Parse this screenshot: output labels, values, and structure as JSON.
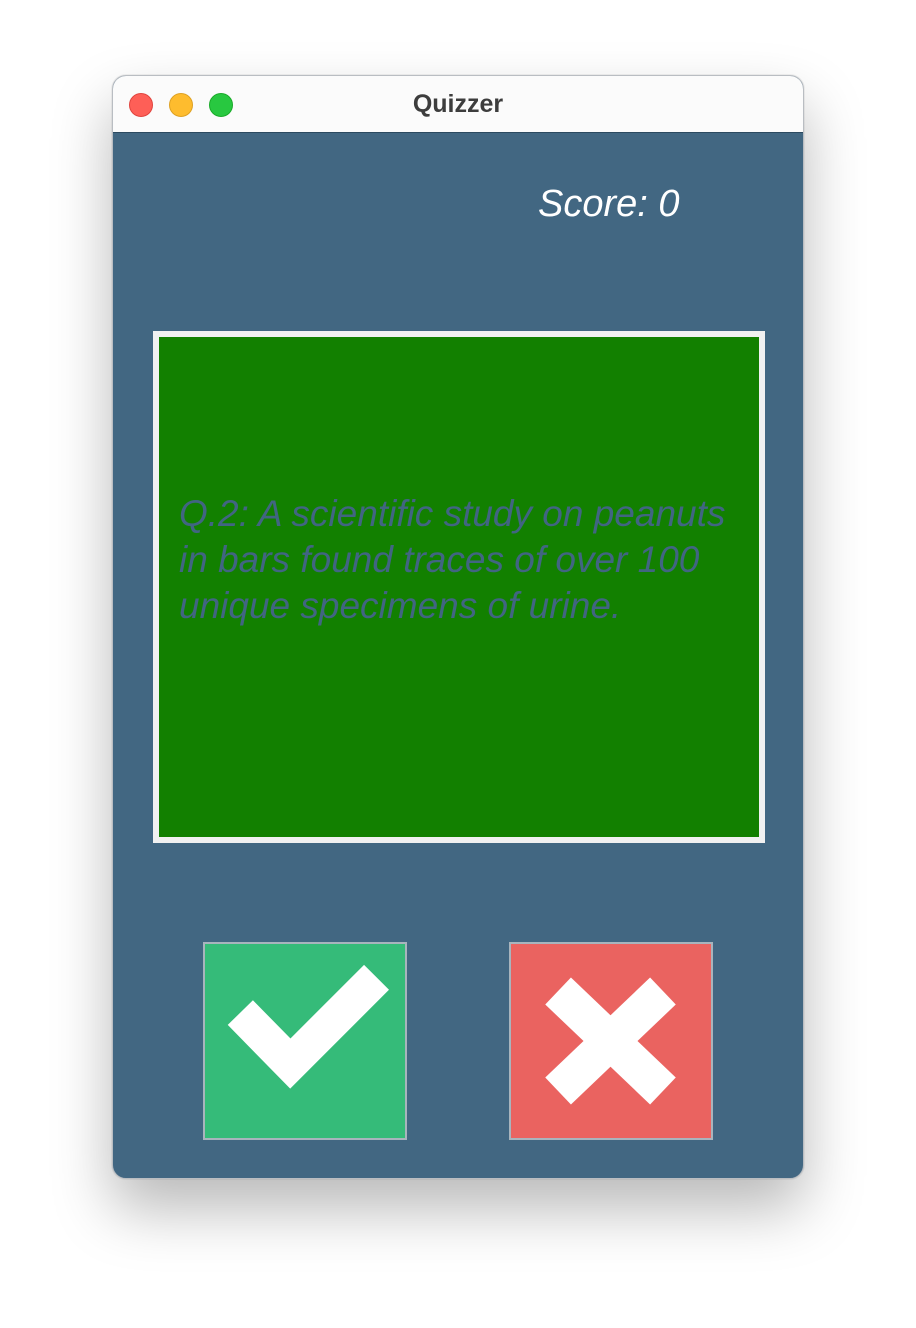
{
  "window": {
    "title": "Quizzer"
  },
  "score": {
    "label": "Score: 0"
  },
  "question": {
    "text": "Q.2: A scientific study on peanuts in bars found traces of over 100 unique specimens of urine."
  },
  "buttons": {
    "true_icon": "checkmark-icon",
    "false_icon": "cross-icon"
  },
  "colors": {
    "background": "#426782",
    "card": "#128000",
    "true_button": "#35bb79",
    "false_button": "#ea6360"
  }
}
